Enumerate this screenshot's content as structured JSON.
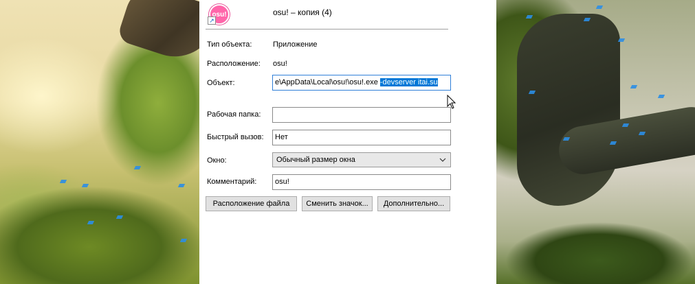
{
  "dialog": {
    "shortcut_name": "osu! – копия (4)",
    "icon_text": "osu!",
    "rows": {
      "type_label": "Тип объекта:",
      "type_value": "Приложение",
      "location_label": "Расположение:",
      "location_value": "osu!",
      "target_label": "Объект:",
      "target_value_plain": "e\\AppData\\Local\\osu!\\osu!.exe",
      "target_value_selected": "-devserver itai.su",
      "start_in_label": "Рабочая папка:",
      "start_in_value": "",
      "shortcut_key_label": "Быстрый вызов:",
      "shortcut_key_value": "Нет",
      "run_label": "Окно:",
      "run_value": "Обычный размер окна",
      "comment_label": "Комментарий:",
      "comment_value": "osu!"
    },
    "buttons": {
      "open_location": "Расположение файла",
      "change_icon": "Сменить значок...",
      "advanced": "Дополнительно..."
    }
  },
  "colors": {
    "selection": "#0078d7",
    "osu_pink": "#ff66aa"
  },
  "icons": {
    "app": "osu-app-icon",
    "shortcut_overlay": "shortcut-arrow-icon",
    "dropdown": "chevron-down-icon",
    "pointer": "mouse-cursor-icon"
  }
}
